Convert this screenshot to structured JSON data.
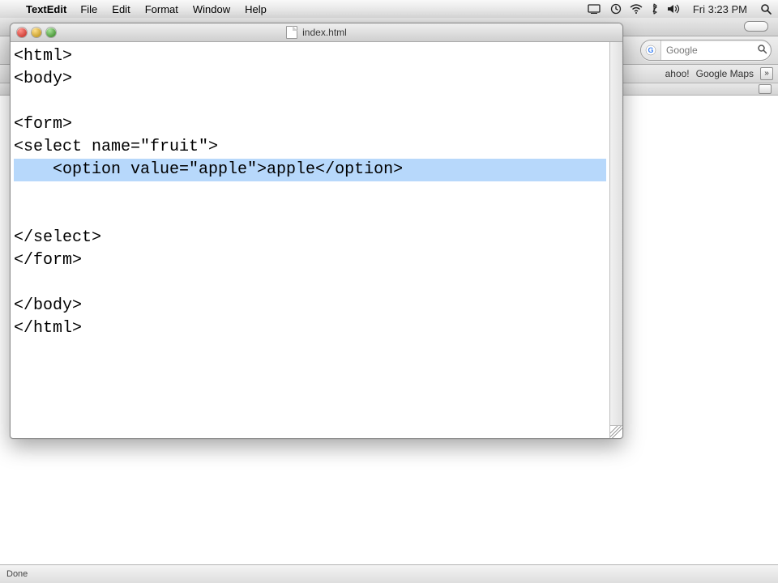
{
  "menubar": {
    "app": "TextEdit",
    "items": [
      "File",
      "Edit",
      "Format",
      "Window",
      "Help"
    ],
    "clock": "Fri 3:23 PM"
  },
  "browser": {
    "search_placeholder": "Google",
    "bookmarks": [
      "ahoo!",
      "Google Maps"
    ]
  },
  "window": {
    "title": "index.html"
  },
  "editor": {
    "lines": [
      "<html>",
      "<body>",
      "",
      "<form>",
      "<select name=\"fruit\">",
      "    <option value=\"apple\">apple</option>",
      "",
      "",
      "</select>",
      "</form>",
      "",
      "</body>",
      "</html>"
    ],
    "selected_line_index": 5
  },
  "statusbar": {
    "text": "Done"
  }
}
